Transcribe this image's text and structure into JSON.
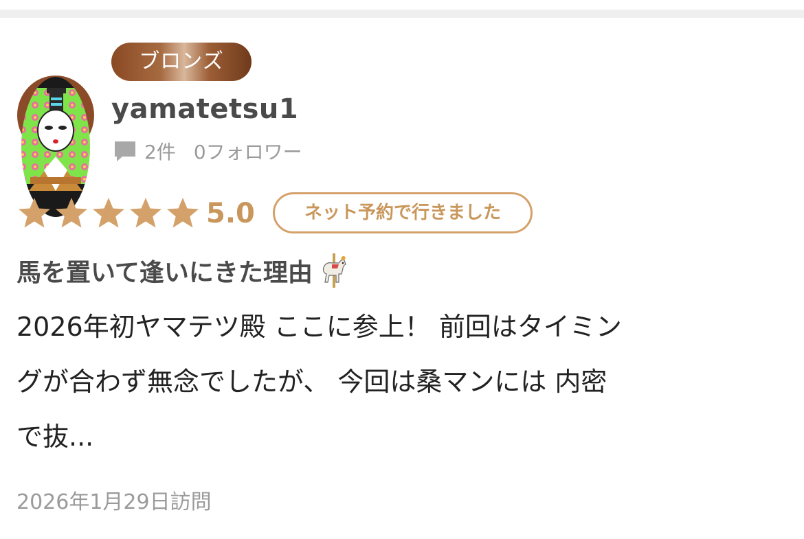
{
  "rank": {
    "label": "ブロンズ"
  },
  "user": {
    "name": "yamatetsu1",
    "review_count": "2件",
    "followers": "0フォロワー",
    "avatar_icon": "user-avatar-illustration"
  },
  "rating": {
    "value": 5.0,
    "score_label": "5.0",
    "stars_filled": 5,
    "stars_total": 5
  },
  "booking_tag": "ネット予約で行きました",
  "review": {
    "title": "馬を置いて逢いにきた理由",
    "title_icon": "carousel-horse-icon",
    "body_lines": [
      "2026年初ヤマテツ殿 ここに参上！ 前回はタイミン",
      "グが合わず無念でしたが、 今回は桑マンには 内密",
      "で抜..."
    ],
    "visit_date": "2026年1月29日訪問"
  },
  "colors": {
    "accent_gold": "#c9975b",
    "tag_border": "#d4a16a",
    "bronze": "#8a4a24",
    "muted_text": "#9a9a9a",
    "title_text": "#4a4a4a"
  }
}
